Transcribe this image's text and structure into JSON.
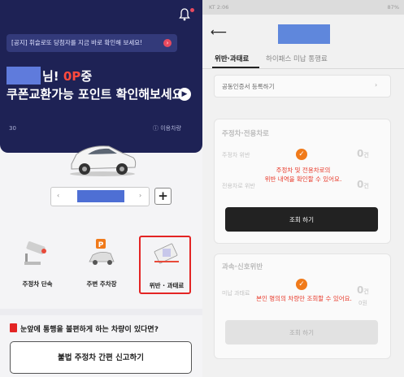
{
  "left_screen": {
    "notice": "[공지] 휘슬로또 당첨자를 지금 바로 확인해 보세요!",
    "greeting_line1_prefix": "님! ",
    "greeting_points": "0P",
    "greeting_line1_suffix": "중",
    "greeting_line2": "쿠폰교환가능 포인트 확인해보세요!",
    "small_label_left": "30",
    "used_car_link": "이용차량",
    "menu": [
      {
        "label": "주정차 단속",
        "selected": false
      },
      {
        "label": "주변 주차장",
        "selected": false
      },
      {
        "label": "위반 · 과태료",
        "selected": true
      }
    ],
    "question": "눈앞에 통행을 불편하게 하는 차량이 있다면?",
    "report_button": "불법 주정차 간편 신고하기",
    "colors": {
      "hero_bg": "#1e2255",
      "accent_red": "#e32424",
      "points_red": "#ff4a3d"
    }
  },
  "right_screen": {
    "status_left": "KT 2:06",
    "status_right": "87%",
    "tabs": [
      "위반·과태료",
      "하이패스 미납 통행료"
    ],
    "cert_row": "공동인증서 등록하기",
    "card1": {
      "title": "주정차·전용차로",
      "rows": [
        {
          "label": "주정차 위반",
          "value": "0",
          "unit": "건"
        },
        {
          "label": "전용차로 위반",
          "value": "0",
          "unit": "건"
        }
      ],
      "overlay_message_line1": "주정차 및 전용차로의",
      "overlay_message_line2": "위반 내역을 확인할 수 있어요.",
      "button": "조회 하기"
    },
    "card2": {
      "title": "과속·신호위반",
      "rows": [
        {
          "label": "미납 과태료",
          "value": "0",
          "unit": "건"
        }
      ],
      "sub_value": "0원",
      "overlay_message": "본인 명의의 차량만 조회할 수 있어요.",
      "button": "조회 하기"
    },
    "colors": {
      "check_orange": "#f07a1a",
      "message_red": "#e8392a"
    }
  },
  "icons": [
    "bell-icon",
    "arrow-right-icon",
    "back-arrow-icon",
    "check-icon",
    "plus-icon",
    "cctv-icon",
    "parking-icon",
    "ticket-icon",
    "warning-icon"
  ]
}
